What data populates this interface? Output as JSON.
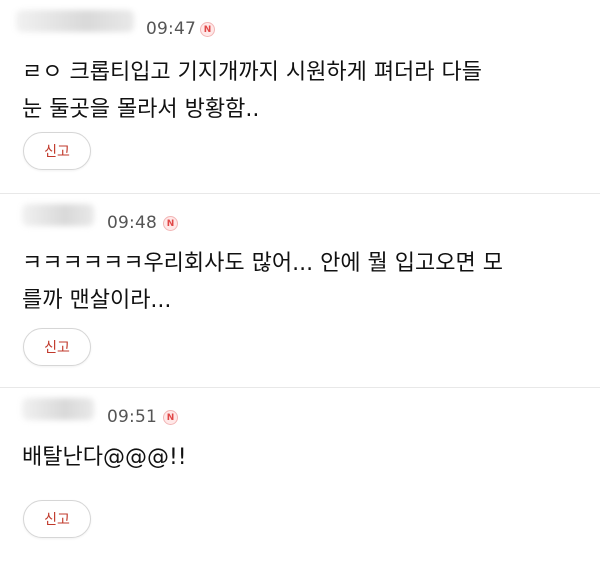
{
  "comments": [
    {
      "time": "09:47",
      "badge": "N",
      "text": "ㄹㅇ 크롭티입고 기지개까지 시원하게 펴더라 다들\n눈 둘곳을 몰라서 방황함..",
      "report_label": "신고"
    },
    {
      "time": "09:48",
      "badge": "N",
      "text": "ㅋㅋㅋㅋㅋㅋ우리회사도 많어... 안에 뭘 입고오면 모\n를까 맨살이라...",
      "report_label": "신고"
    },
    {
      "time": "09:51",
      "badge": "N",
      "text": "배탈난다@@@!!",
      "report_label": "신고"
    }
  ]
}
